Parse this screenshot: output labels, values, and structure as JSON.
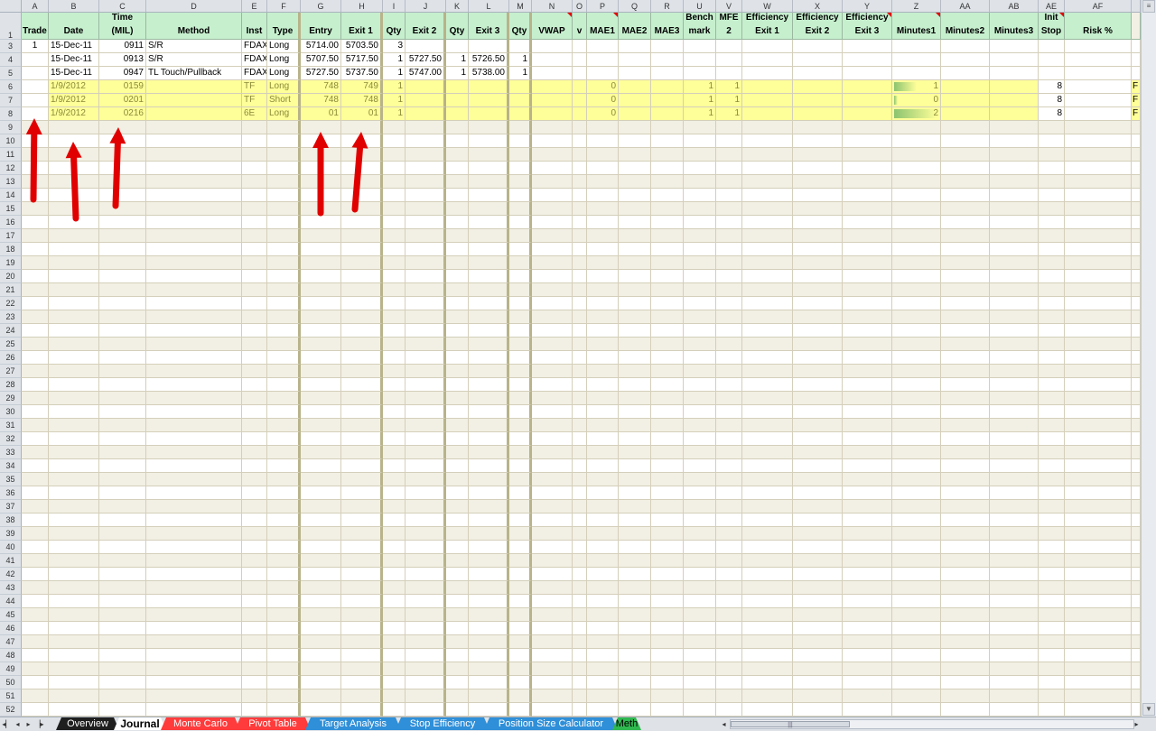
{
  "columns": [
    {
      "letter": "A",
      "header": [
        "Trade"
      ]
    },
    {
      "letter": "B",
      "header": [
        "Date"
      ]
    },
    {
      "letter": "C",
      "header": [
        "Time",
        "(MIL)"
      ]
    },
    {
      "letter": "D",
      "header": [
        "Method"
      ]
    },
    {
      "letter": "E",
      "header": [
        "Inst"
      ]
    },
    {
      "letter": "F",
      "header": [
        "Type"
      ]
    },
    {
      "letter": "G",
      "header": [
        "Entry"
      ]
    },
    {
      "letter": "H",
      "header": [
        "Exit 1"
      ]
    },
    {
      "letter": "I",
      "header": [
        "Qty"
      ]
    },
    {
      "letter": "J",
      "header": [
        "Exit 2"
      ]
    },
    {
      "letter": "K",
      "header": [
        "Qty"
      ]
    },
    {
      "letter": "L",
      "header": [
        "Exit 3"
      ]
    },
    {
      "letter": "M",
      "header": [
        "Qty"
      ]
    },
    {
      "letter": "N",
      "header": [
        "VWAP"
      ]
    },
    {
      "letter": "O",
      "header": [
        "v"
      ]
    },
    {
      "letter": "P",
      "header": [
        "MAE1"
      ]
    },
    {
      "letter": "Q",
      "header": [
        "MAE2"
      ]
    },
    {
      "letter": "R",
      "header": [
        "MAE3"
      ]
    },
    {
      "letter": "U",
      "header": [
        "Bench",
        "mark"
      ]
    },
    {
      "letter": "V",
      "header": [
        "MFE",
        "2"
      ]
    },
    {
      "letter": "W",
      "header": [
        "Efficiency",
        "Exit 1"
      ]
    },
    {
      "letter": "X",
      "header": [
        "Efficiency",
        "Exit 2"
      ]
    },
    {
      "letter": "Y",
      "header": [
        "Efficiency",
        "Exit 3"
      ]
    },
    {
      "letter": "Z",
      "header": [
        "Minutes1"
      ]
    },
    {
      "letter": "AA",
      "header": [
        "Minutes2"
      ]
    },
    {
      "letter": "AB",
      "header": [
        "Minutes3"
      ]
    },
    {
      "letter": "AE",
      "header": [
        "Init",
        "Stop"
      ]
    },
    {
      "letter": "AF",
      "header": [
        "Risk %"
      ]
    },
    {
      "letter": "",
      "header": [
        ""
      ]
    }
  ],
  "header_row_number": "1",
  "rows": [
    {
      "n": "3",
      "style": "white",
      "cells": {
        "A": "1",
        "B": "15-Dec-11",
        "C": "0911",
        "D": "S/R",
        "E": "FDAX",
        "F": "Long",
        "G": "5714.00",
        "H": "5703.50",
        "I": "3"
      }
    },
    {
      "n": "4",
      "style": "white",
      "cells": {
        "B": "15-Dec-11",
        "C": "0913",
        "D": "S/R",
        "E": "FDAX",
        "F": "Long",
        "G": "5707.50",
        "H": "5717.50",
        "I": "1",
        "J": "5727.50",
        "K": "1",
        "L": "5726.50",
        "M": "1"
      }
    },
    {
      "n": "5",
      "style": "white",
      "cells": {
        "B": "15-Dec-11",
        "C": "0947",
        "D": "TL Touch/Pullback",
        "E": "FDAX",
        "F": "Long",
        "G": "5727.50",
        "H": "5737.50",
        "I": "1",
        "J": "5747.00",
        "K": "1",
        "L": "5738.00",
        "M": "1"
      }
    },
    {
      "n": "6",
      "style": "yellow",
      "cells": {
        "B": "1/9/2012",
        "C": "0159",
        "E": "TF",
        "F": "Long",
        "G": "748",
        "H": "749",
        "I": "1",
        "P": "0",
        "U": "1",
        "V": "1",
        "Z": "1",
        "AE": "8",
        "end": "F"
      },
      "minutes_bar": 0.5
    },
    {
      "n": "7",
      "style": "yellow",
      "cells": {
        "B": "1/9/2012",
        "C": "0201",
        "E": "TF",
        "F": "Short",
        "G": "748",
        "H": "748",
        "I": "1",
        "P": "0",
        "U": "1",
        "V": "1",
        "Z": "0",
        "AE": "8",
        "end": "F"
      },
      "minutes_bar": 0.08
    },
    {
      "n": "8",
      "style": "yellow",
      "cells": {
        "B": "1/9/2012",
        "C": "0216",
        "E": "6E",
        "F": "Long",
        "G": "01",
        "H": "01",
        "I": "1",
        "P": "0",
        "U": "1",
        "V": "1",
        "Z": "2",
        "AE": "8",
        "end": "F"
      },
      "minutes_bar": 0.95
    }
  ],
  "empty_row_numbers": [
    "9",
    "10",
    "11",
    "12",
    "13",
    "14",
    "15",
    "16",
    "17",
    "18",
    "19",
    "20",
    "21",
    "22",
    "23",
    "24",
    "25",
    "26",
    "27",
    "28",
    "29",
    "30",
    "31",
    "32",
    "33",
    "34",
    "35",
    "36",
    "37",
    "38",
    "39",
    "40",
    "41",
    "42",
    "43",
    "44",
    "45",
    "46",
    "47",
    "48",
    "49",
    "50",
    "51",
    "52"
  ],
  "comment_indicator_columns": [
    "N",
    "P",
    "AE",
    "Y",
    "Z"
  ],
  "sheet_tabs": [
    {
      "label": "Overview",
      "bg": "#1f1f1f",
      "fg": "#ffffff",
      "active": false
    },
    {
      "label": "Journal",
      "bg": "#ffffff",
      "fg": "#000000",
      "active": true
    },
    {
      "label": "Monte Carlo",
      "bg": "#ff3b3b",
      "fg": "#ffffff",
      "active": false
    },
    {
      "label": "Pivot Table",
      "bg": "#ff3b3b",
      "fg": "#ffffff",
      "active": false
    },
    {
      "label": "Target Analysis",
      "bg": "#2f8fd8",
      "fg": "#ffffff",
      "active": false
    },
    {
      "label": "Stop Efficiency",
      "bg": "#2f8fd8",
      "fg": "#ffffff",
      "active": false
    },
    {
      "label": "Position Size Calculator",
      "bg": "#2f8fd8",
      "fg": "#ffffff",
      "active": false
    },
    {
      "label": "Meth",
      "bg": "#2fb84f",
      "fg": "#000000",
      "active": false
    }
  ],
  "colors": {
    "header_green": "#c6efce",
    "row_yellow": "#ffff99",
    "grid_beige": "#f2f0e4",
    "arrow_red": "#e00000"
  },
  "icons": {
    "arrows": "red-up-arrow",
    "nav": [
      "first-sheet-icon",
      "prev-sheet-icon",
      "next-sheet-icon",
      "last-sheet-icon"
    ]
  }
}
